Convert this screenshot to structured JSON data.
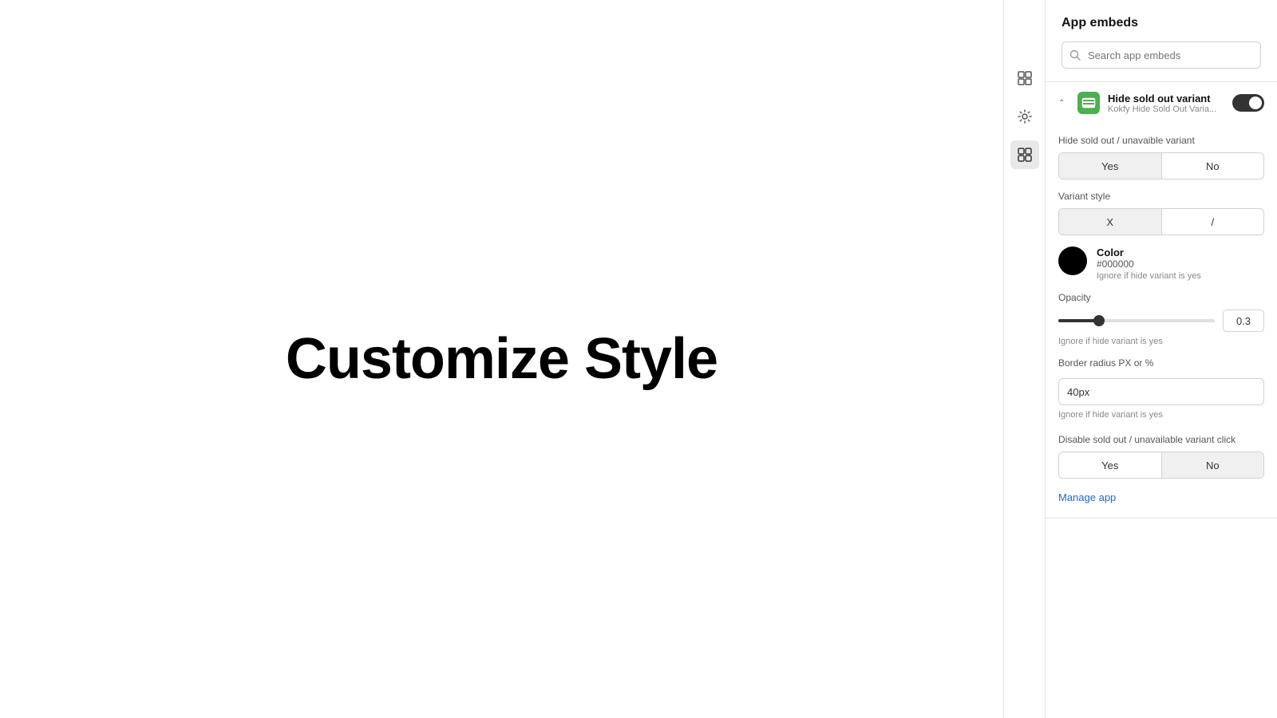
{
  "main": {
    "title": "Customize Style"
  },
  "icon_rail": {
    "icons": [
      {
        "name": "layout-icon",
        "label": "Layout",
        "active": false
      },
      {
        "name": "settings-icon",
        "label": "Settings",
        "active": false
      },
      {
        "name": "apps-icon",
        "label": "Apps",
        "active": true
      }
    ]
  },
  "panel": {
    "title": "App embeds",
    "search": {
      "placeholder": "Search app embeds"
    },
    "embed": {
      "name": "Hide sold out variant",
      "subtitle": "Kokfy Hide Sold Out Varia...",
      "toggle_on": true,
      "hide_sold_out": {
        "label": "Hide sold out / unavaible variant",
        "yes_label": "Yes",
        "no_label": "No",
        "active": "yes"
      },
      "variant_style": {
        "label": "Variant style",
        "x_label": "X",
        "slash_label": "/",
        "active": "x"
      },
      "color": {
        "label": "Color",
        "value": "#000000",
        "hint": "Ignore if hide variant is yes"
      },
      "opacity": {
        "label": "Opacity",
        "value": "0.3",
        "hint": "Ignore if hide variant is yes",
        "fill_percent": 28
      },
      "border_radius": {
        "label": "Border radius PX or %",
        "value": "40px",
        "hint": "Ignore if hide variant is yes"
      },
      "disable_click": {
        "label": "Disable sold out / unavailable variant click",
        "yes_label": "Yes",
        "no_label": "No",
        "active": "no"
      },
      "manage_app_link": "Manage app"
    }
  }
}
